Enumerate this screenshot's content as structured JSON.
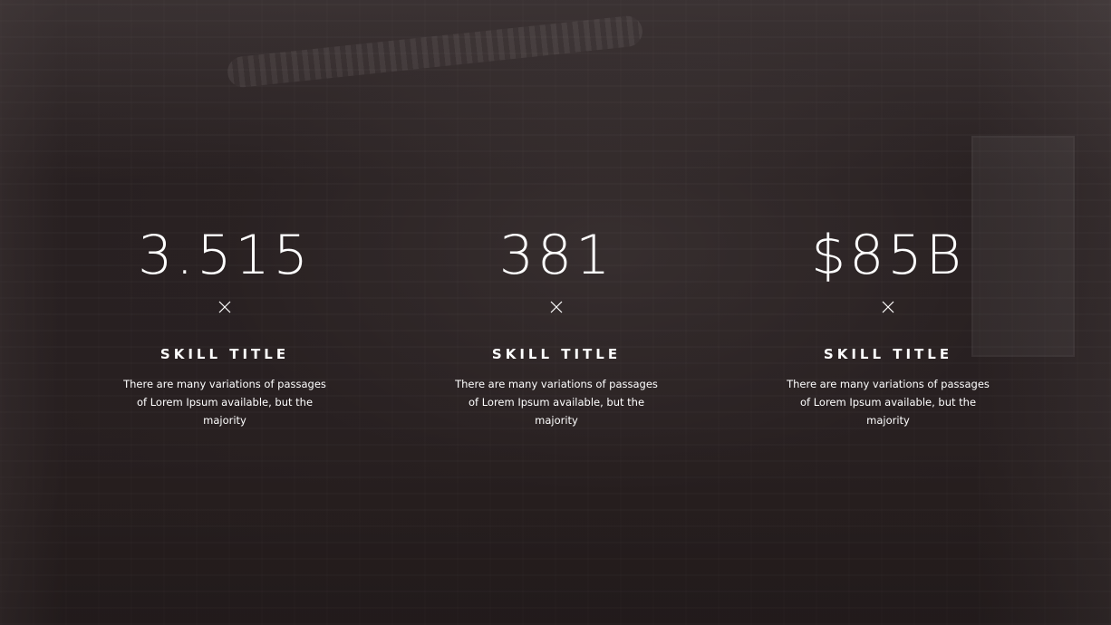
{
  "stats": [
    {
      "value": "3.515",
      "title": "SKILL TITLE",
      "description": "There are many variations of passages of Lorem Ipsum available, but the majority",
      "icon": "close-icon"
    },
    {
      "value": "381",
      "title": "SKILL TITLE",
      "description": "There are many variations of passages of Lorem Ipsum available, but the majority",
      "icon": "close-icon"
    },
    {
      "value": "$85B",
      "title": "SKILL TITLE",
      "description": "There are many variations of passages of Lorem Ipsum available, but the majority",
      "icon": "close-icon"
    }
  ],
  "colors": {
    "overlay": "#2b2324",
    "text": "#ffffff"
  }
}
